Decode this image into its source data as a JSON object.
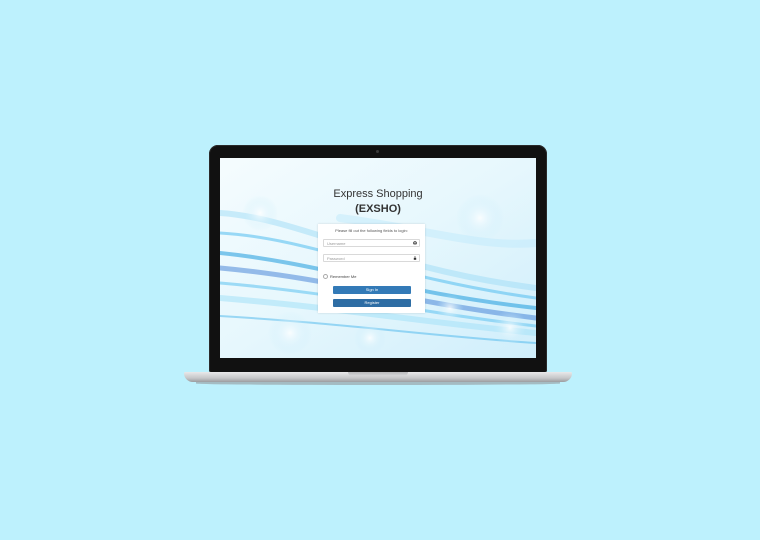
{
  "app": {
    "title_line1": "Express Shopping",
    "title_line2": "(EXSHO)"
  },
  "login": {
    "hint": "Please fill out the following fields to login:",
    "username_placeholder": "Username",
    "password_placeholder": "Password",
    "remember_label": "Remember Me",
    "signin_label": "Sign In",
    "register_label": "Register"
  },
  "icons": {
    "username": "user-circle-icon",
    "password": "lock-icon"
  },
  "colors": {
    "page_background": "#bdf1fd",
    "primary_button": "#337ab7",
    "register_button": "#2e6da4"
  }
}
